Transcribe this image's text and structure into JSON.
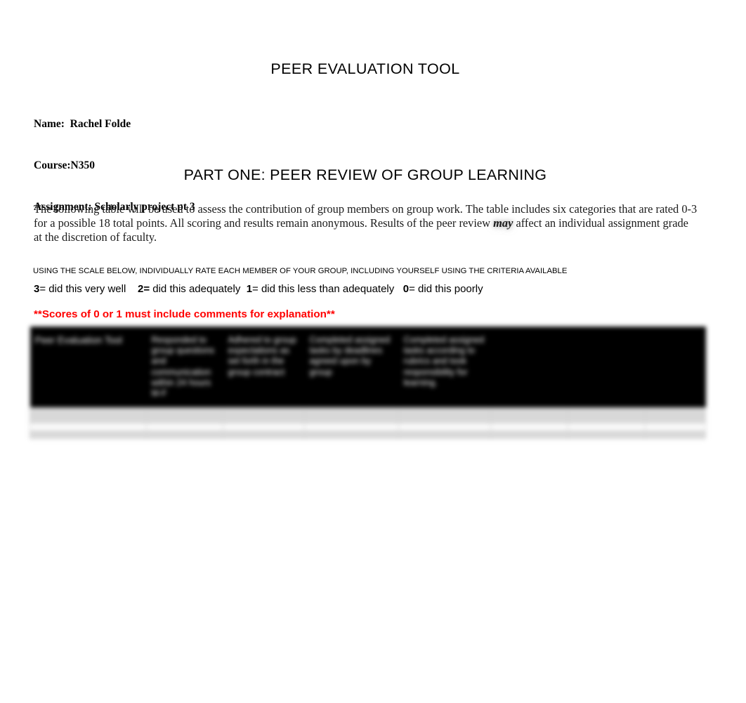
{
  "document": {
    "title": "PEER EVALUATION TOOL",
    "identity": {
      "name_line": "Name:  Rachel Folde",
      "course_line": "Course:N350",
      "assignment_line": "Assignment: Scholarly project pt 3"
    },
    "part_one_heading": "PART ONE: PEER REVIEW OF GROUP LEARNING",
    "intro_paragraph": {
      "before_emphasis": "The following table will be used to assess the contribution of group members on group work. The table includes six categories that are rated 0-3 for a possible 18 total points. All scoring and results remain anonymous. Results of the peer review ",
      "emphasis": "may",
      "after_emphasis": " affect an individual assignment grade at the discretion of faculty."
    },
    "instruction_line": "USING THE SCALE BELOW, INDIVIDUALLY RATE EACH MEMBER OF YOUR GROUP, INCLUDING YOURSELF USING THE CRITERIA AVAILABLE",
    "scale": {
      "score_3": "3",
      "label_3": "= did this very well",
      "score_2": "2=",
      "label_2": " did this adequately  ",
      "score_1": "1",
      "label_1": "= did this less than adequately   ",
      "score_0": "0",
      "label_0": "= did this poorly",
      "gap": "    "
    },
    "warning_note": "**Scores of 0 or 1 must include comments for explanation**"
  },
  "colors": {
    "warning_red": "#ff0000",
    "header_fill": "#000000",
    "header_text": "#f2f2f2",
    "body_row_gray": "#d8d8d8",
    "body_row_light": "#fbfbfb"
  },
  "rubric_table": {
    "headers": [
      "Peer Evaluation Tool",
      "Responded to group questions and communication within 24 hours M-F",
      "Adhered to group expectations as set forth in the group contract",
      "Completed assigned tasks by deadlines agreed upon by group",
      "Completed assigned tasks according to rubrics and took responsibility for learning.",
      "",
      "",
      ""
    ],
    "rows": [
      {
        "cells": [
          "",
          "",
          "",
          "",
          "",
          "",
          "",
          ""
        ]
      },
      {
        "cells": [
          "",
          "",
          "",
          "",
          "",
          "",
          "",
          ""
        ]
      },
      {
        "cells": [
          "",
          "",
          "",
          "",
          "",
          "",
          "",
          ""
        ]
      },
      {
        "cells": [
          "",
          "",
          "",
          "",
          "",
          "",
          "",
          ""
        ]
      }
    ]
  }
}
